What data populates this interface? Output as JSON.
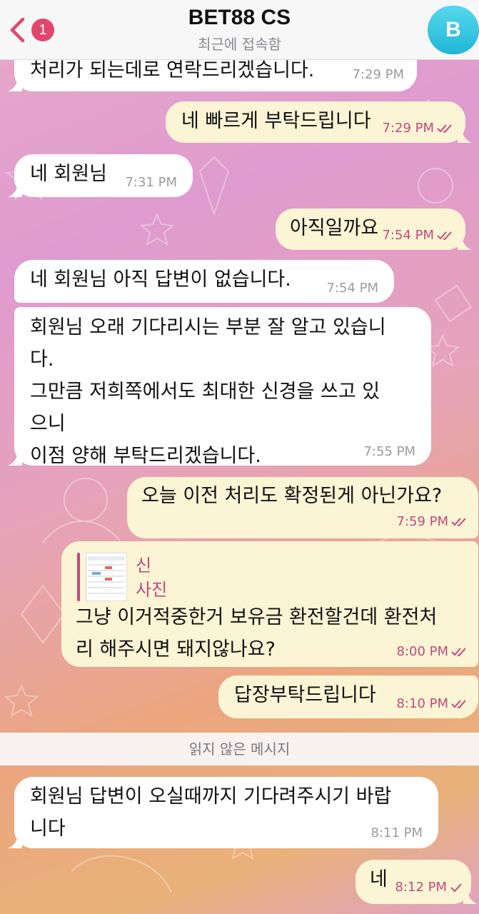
{
  "header": {
    "back_badge": "1",
    "title": "BET88 CS",
    "subtitle": "최근에 접속함",
    "avatar_letter": "B"
  },
  "messages": [
    {
      "dir": "in",
      "text": "처리가 되는데로 연락드리겠습니다.",
      "time": "7:29 PM"
    },
    {
      "dir": "out",
      "text": "네 빠르게 부탁드립니다",
      "time": "7:29 PM",
      "status": "read"
    },
    {
      "dir": "in",
      "text": "네 회원님",
      "time": "7:31 PM"
    },
    {
      "dir": "out",
      "text": "아직일까요",
      "time": "7:54 PM",
      "status": "read"
    },
    {
      "dir": "in",
      "text": "네 회원님 아직 답변이 없습니다.",
      "time": "7:54 PM"
    },
    {
      "dir": "in",
      "text": "회원님 오래 기다리시는 부분 잘 알고 있습니\n다.\n그만큼 저희쪽에서도 최대한 신경을 쓰고 있\n으니\n이점 양해 부탁드리겠습니다.",
      "time": "7:55 PM"
    },
    {
      "dir": "out",
      "text": "오늘 이전 처리도 확정된게 아닌가요?",
      "time": "7:59 PM",
      "status": "read"
    },
    {
      "dir": "out",
      "reply_name": "신",
      "reply_text": "사진",
      "text": "그냥 이거적중한거 보유금 환전할건데 환전처\n리 해주시면 돼지않나요?",
      "time": "8:00 PM",
      "status": "read"
    },
    {
      "dir": "out",
      "text": "답장부탁드립니다",
      "time": "8:10 PM",
      "status": "read"
    },
    {
      "dir": "in",
      "text": "회원님 답변이 오실때까지 기다려주시기 바랍\n니다",
      "time": "8:11 PM"
    },
    {
      "dir": "out",
      "text": "네",
      "time": "8:12 PM",
      "status": "sent"
    }
  ],
  "unread_divider": "읽지 않은 메시지",
  "colors": {
    "accent": "#e2466e",
    "outgoing_bubble": "#fbf4d5",
    "incoming_bubble": "#ffffff",
    "outgoing_time": "#c44a7d",
    "avatar": "#1fb6d6"
  }
}
